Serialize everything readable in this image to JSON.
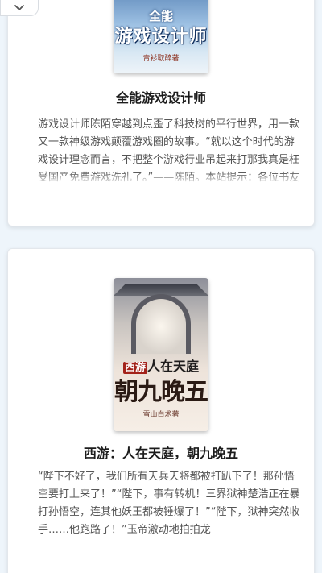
{
  "nav": {
    "back_icon": "chevron-down-icon"
  },
  "books": [
    {
      "cover": {
        "title_top": "全能",
        "title_main": "游戏设计师",
        "author": "青衫取醉著"
      },
      "title": "全能游戏设计师",
      "description": "游戏设计师陈陌穿越到点歪了科技树的平行世界，用一款又一款神级游戏颠覆游戏圈的故事。“就以这个时代的游戏设计理念而言，不把整个游戏行业吊起来打那我真是枉受国产免费游戏洗礼了。”——陈陌。本站提示：各位书友要是觉得《全能游戏设计师》还不错的话"
    },
    {
      "cover": {
        "sub_prefix": "西游",
        "sub_rest": "人在天庭",
        "main": "朝九晚五",
        "author": "雪山白术著"
      },
      "title": "西游：人在天庭，朝九晚五",
      "description": "“陛下不好了，我们所有天兵天将都被打趴下了！那孙悟空要打上来了！”“陛下，事有转机！三界狱神楚浩正在暴打孙悟空，连其他妖王都被锤爆了！”“陛下，狱神突然收手……他跑路了！”玉帝激动地拍拍龙"
    }
  ],
  "colors": {
    "background": "#eef5fb",
    "card": "#ffffff",
    "title_text": "#1c1c1c",
    "body_text": "#555555"
  }
}
